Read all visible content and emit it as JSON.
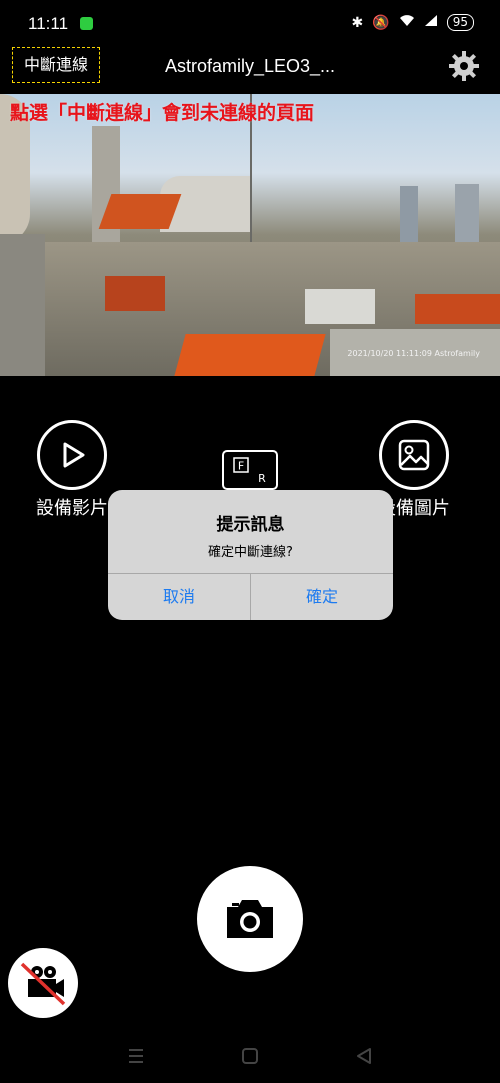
{
  "status_bar": {
    "time": "11:11",
    "battery": "95"
  },
  "header": {
    "disconnect_label": "中斷連線",
    "title": "Astrofamily_LEO3_..."
  },
  "preview": {
    "annotation": "點選「中斷連線」會到未連線的頁面",
    "stamp": "2021/10/20 11:11:09    Astrofamily"
  },
  "actions": {
    "device_video_label": "設備影片",
    "device_photo_label": "設備圖片"
  },
  "dialog": {
    "title": "提示訊息",
    "message": "確定中斷連線?",
    "cancel_label": "取消",
    "confirm_label": "確定"
  },
  "colors": {
    "accent_blue": "#1d7bf0",
    "annotation_red": "#e8141b",
    "highlight_yellow": "#f5d300"
  }
}
